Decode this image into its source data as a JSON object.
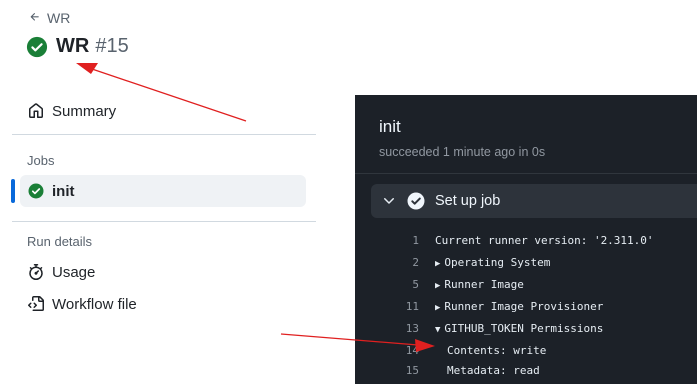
{
  "header": {
    "back_label": "WR",
    "run_name": "WR",
    "run_number": "#15",
    "status_color": "#1a7f37"
  },
  "sidebar": {
    "summary_label": "Summary",
    "jobs_section_label": "Jobs",
    "jobs": [
      {
        "label": "init",
        "status": "success"
      }
    ],
    "run_details_label": "Run details",
    "usage_label": "Usage",
    "workflow_file_label": "Workflow file",
    "accent_color": "#0969da"
  },
  "log": {
    "job_title": "init",
    "job_status": "succeeded 1 minute ago in 0s",
    "step": {
      "name": "Set up job",
      "expanded": true
    },
    "lines": [
      {
        "num": "1",
        "text": "Current runner version: '2.311.0'",
        "marker": ""
      },
      {
        "num": "2",
        "text": "Operating System",
        "marker": "▶"
      },
      {
        "num": "5",
        "text": "Runner Image",
        "marker": "▶"
      },
      {
        "num": "11",
        "text": "Runner Image Provisioner",
        "marker": "▶"
      },
      {
        "num": "13",
        "text": "GITHUB_TOKEN Permissions",
        "marker": "▼"
      },
      {
        "num": "14",
        "text": "Contents: write",
        "marker": ""
      },
      {
        "num": "15",
        "text": "Metadata: read",
        "marker": ""
      }
    ]
  },
  "annotation_color": "#e02020"
}
